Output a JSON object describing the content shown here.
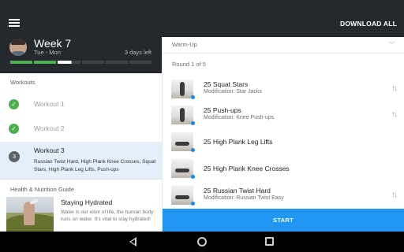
{
  "appbar": {
    "menu_icon": "hamburger-menu-icon",
    "download_all_label": "DOWNLOAD ALL"
  },
  "program": {
    "week_title": "Week 7",
    "days": "Tue - Mon",
    "days_left": "3 days left",
    "progress_segments": 6,
    "progress_completed_segments": 2,
    "progress_active_segment_fill": 0.6,
    "colors": {
      "completed": "#4caf50",
      "active": "#ffffff",
      "remaining": "#3f4449"
    }
  },
  "workouts": {
    "section_label": "Workouts",
    "items": [
      {
        "label": "Workout 1",
        "status": "completed",
        "icon": "check-circle-icon"
      },
      {
        "label": "Workout 2",
        "status": "completed",
        "icon": "check-circle-icon"
      }
    ],
    "active": {
      "number": "3",
      "label": "Workout 3",
      "description": "Russian Twist Hard, High Plank Knee Crosses, Squat Stars, High Plank Leg Lifts, Push-ups"
    }
  },
  "guide": {
    "section_label": "Health & Nutrition Guide",
    "article": {
      "title": "Staying Hydrated",
      "description": "Water is our elixir of life, the human body runs on water. It's vital to stay hydrated!"
    }
  },
  "circuit": {
    "warmup_label": "Warm-Up",
    "round_label": "Round 1 of 5",
    "exercises": [
      {
        "name": "25 Squat Stars",
        "modification": "Modification: Star Jacks",
        "swappable": true
      },
      {
        "name": "25 Push-ups",
        "modification": "Modification: Knee Push-ups",
        "swappable": true
      },
      {
        "name": "25 High Plank Leg Lifts",
        "modification": "",
        "swappable": false
      },
      {
        "name": "25 High Plank Knee Crosses",
        "modification": "",
        "swappable": false
      },
      {
        "name": "25 Russian Twist Hard",
        "modification": "Modification: Russian Twist Easy",
        "swappable": true
      }
    ],
    "start_label": "START"
  },
  "colors": {
    "accent": "#2196f3",
    "header_bg": "#25282c",
    "active_row_bg": "#e3effa",
    "check_green": "#4caf50"
  }
}
